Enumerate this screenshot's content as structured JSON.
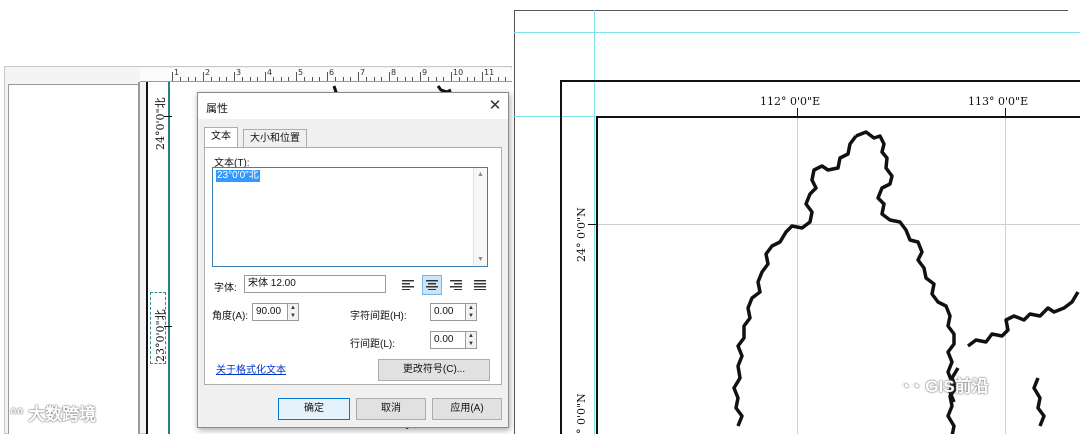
{
  "dialog": {
    "title": "属性",
    "close_glyph": "✕",
    "tabs": [
      {
        "label": "文本",
        "active": true
      },
      {
        "label": "大小和位置",
        "active": false
      }
    ],
    "text_label": "文本(T):",
    "text_value": "23°0'0\"北",
    "font_label": "字体:",
    "font_value": "宋体 12.00",
    "angle_label": "角度(A):",
    "angle_value": "90.00",
    "char_spacing_label": "字符间距(H):",
    "char_spacing_value": "0.00",
    "line_spacing_label": "行间距(L):",
    "line_spacing_value": "0.00",
    "format_link": "关于格式化文本",
    "change_symbol_button": "更改符号(C)...",
    "ok_button": "确定",
    "cancel_button": "取消",
    "apply_button": "应用(A)",
    "align_icons": [
      "align-left-icon",
      "align-center-icon",
      "align-right-icon",
      "align-justify-icon"
    ],
    "active_align": "align-center-icon"
  },
  "left_map": {
    "ruler_numbers": [
      "1",
      "2",
      "3",
      "4",
      "5",
      "6",
      "7",
      "8",
      "9",
      "10",
      "11"
    ],
    "label_top": "24°0'0\"北",
    "label_bottom": "23°0'0\"北"
  },
  "right_map": {
    "lon_labels": [
      "112°  0'0\"E",
      "113°  0'0\"E"
    ],
    "lat_labels": [
      "24°  0'0\"N",
      "24°  0'0\"N"
    ]
  },
  "watermarks": {
    "left": "大数跨境",
    "right": "GIS前沿"
  },
  "colors": {
    "selection": "#3399ff",
    "focus_border": "#3c7fb1",
    "primary_button_border": "#0078d7",
    "link": "#0033cc",
    "guide_cyan": "#7fe0e6"
  }
}
